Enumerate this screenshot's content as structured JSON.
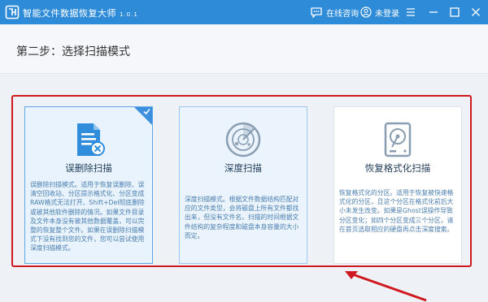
{
  "titlebar": {
    "app_name": "智能文件数据恢复大师",
    "version": "1.0.1",
    "consult_label": "在线咨询",
    "login_label": "未登录"
  },
  "header": {
    "step_title": "第二步：选择扫描模式"
  },
  "cards": [
    {
      "title": "误删除扫描",
      "selected": true,
      "desc": "误删除扫描模式。适用于恢复误删除、误清空回收站、分区提示格式化、分区变成RAW格式无法打开、Shift+Del彻底删除或被其他软件删除的情况。如果文件目录及文件本身没有被其他数据覆盖，可以完整的恢复整个文件。如果在误删除扫描模式下没有找到您的文件，您可以尝试使用深度扫描模式。"
    },
    {
      "title": "深度扫描",
      "selected": false,
      "desc": "深度扫描模式。根据文件数据结构匹配对应的文件类型，会将磁盘上所有文件都找出来，但没有文件名。扫描的时间根据文件结构的复杂程度和磁盘本身容量的大小而定。"
    },
    {
      "title": "恢复格式化扫描",
      "selected": false,
      "desc": "恢复格式化的分区。适用于恢复被快速格式化的分区，且这个分区在格式化前后大小未发生改变。如果是Ghost误操作导致分区变化；如四个分区变成三个分区，请在首页选取相应的硬盘再点击深度搜索。"
    }
  ],
  "colors": {
    "titlebar": "#2e8bd8",
    "highlight_frame": "#d0181f",
    "accent": "#3b8fdc"
  }
}
